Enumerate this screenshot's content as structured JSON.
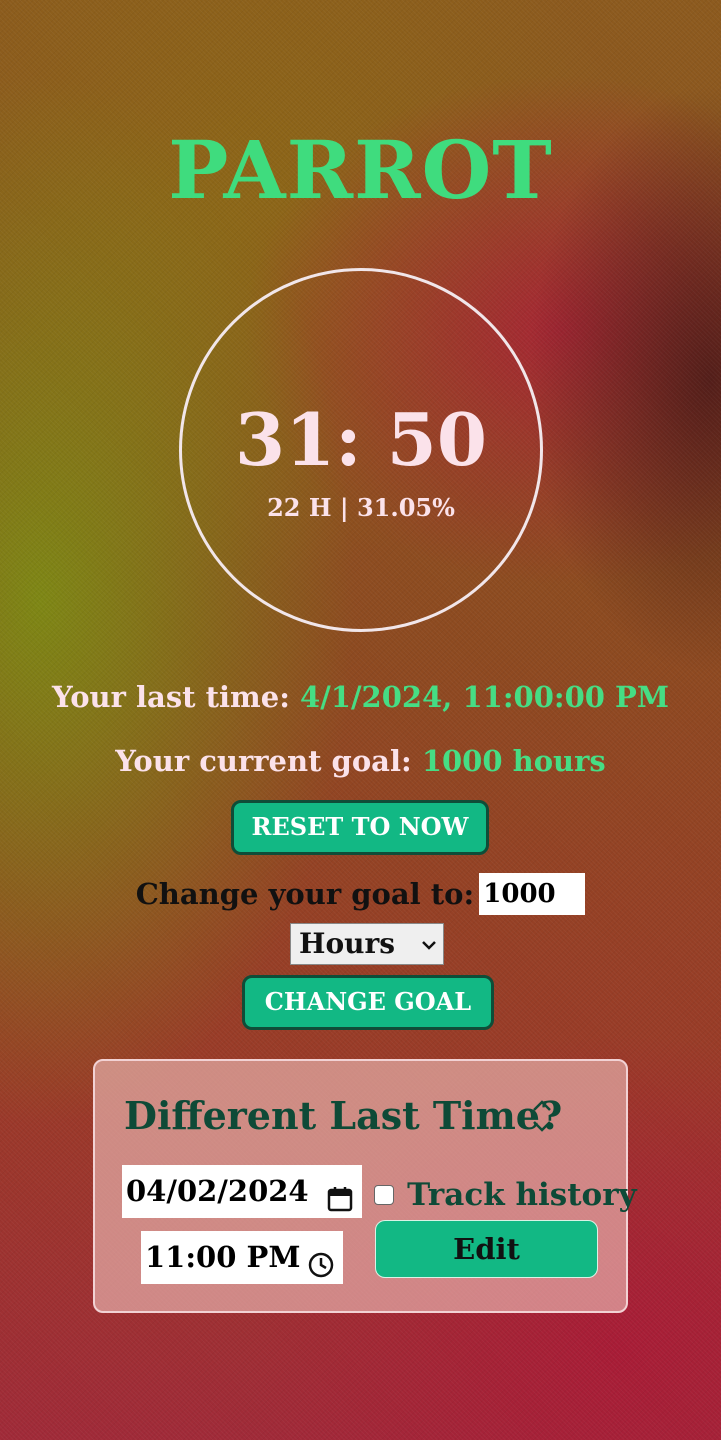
{
  "app": {
    "title": "PARROT"
  },
  "timer": {
    "display": "31: 50",
    "summary": "22 H | 31.05%"
  },
  "last_time": {
    "label": "Your last time:",
    "value": "4/1/2024, 11:00:00 PM"
  },
  "current_goal": {
    "label": "Your current goal:",
    "value": "1000 hours"
  },
  "reset_button": {
    "label": "RESET TO NOW"
  },
  "goal_form": {
    "label": "Change your goal to:",
    "value": "1000",
    "unit_selected": "Hours",
    "submit_label": "CHANGE GOAL"
  },
  "different_last_time": {
    "title": "Different Last Time?",
    "date_value": "04/02/2024",
    "time_value": "11:00 PM",
    "track_history_label": "Track history",
    "track_history_checked": false,
    "edit_label": "Edit"
  },
  "colors": {
    "accent_green": "#46dd84",
    "button_green": "#12b884",
    "dark_green": "#0e4a37",
    "light_pink": "#fbe2ea"
  },
  "icons": {
    "calendar": "calendar-icon",
    "clock": "clock-icon",
    "select_chevron": "chevron-down-icon",
    "expand_toggle": "chevron-up-down-icon"
  }
}
